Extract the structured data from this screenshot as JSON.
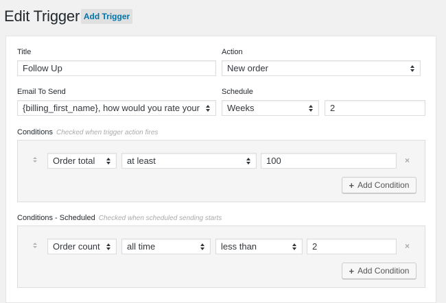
{
  "header": {
    "title": "Edit Trigger",
    "add_trigger_label": "Add Trigger"
  },
  "form": {
    "title_label": "Title",
    "title_value": "Follow Up",
    "action_label": "Action",
    "action_value": "New order",
    "email_label": "Email To Send",
    "email_value": "{billing_first_name}, how would you rate your experience?",
    "schedule_label": "Schedule",
    "schedule_unit": "Weeks",
    "schedule_value": "2"
  },
  "conditions": {
    "label": "Conditions",
    "hint": "Checked when trigger action fires",
    "rows": [
      {
        "field": "Order total",
        "operator": "at least",
        "value": "100"
      }
    ],
    "add_label": "Add Condition"
  },
  "scheduled_conditions": {
    "label": "Conditions - Scheduled",
    "hint": "Checked when scheduled sending starts",
    "rows": [
      {
        "field": "Order count",
        "range": "all time",
        "operator": "less than",
        "value": "2"
      }
    ],
    "add_label": "Add Condition"
  },
  "icons": {
    "plus": "+",
    "remove": "×"
  }
}
